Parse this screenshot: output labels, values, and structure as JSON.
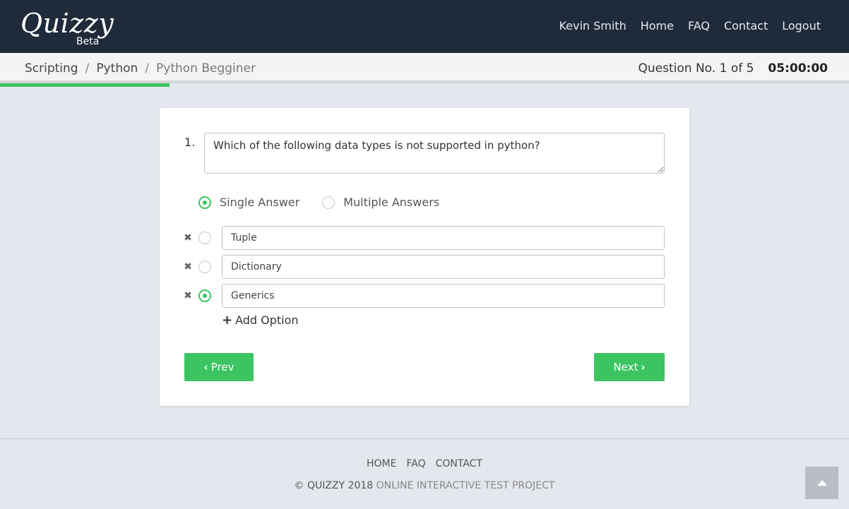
{
  "brand": {
    "name": "Quizzy",
    "tag": "Beta"
  },
  "nav": {
    "user": "Kevin Smith",
    "home": "Home",
    "faq": "FAQ",
    "contact": "Contact",
    "logout": "Logout"
  },
  "breadcrumb": {
    "items": [
      "Scripting",
      "Python",
      "Python Begginer"
    ],
    "separator": "/"
  },
  "quiz": {
    "question_counter": "Question No. 1 of 5",
    "timer": "05:00:00",
    "progress_fraction": 0.2
  },
  "question": {
    "number": "1.",
    "text": "Which of the following data types is not supported in python?",
    "answer_types": {
      "single": "Single Answer",
      "multiple": "Multiple Answers",
      "selected": "single"
    },
    "options": [
      {
        "value": "Tuple",
        "correct": false
      },
      {
        "value": "Dictionary",
        "correct": false
      },
      {
        "value": "Generics",
        "correct": true
      }
    ],
    "add_option_label": "Add Option"
  },
  "buttons": {
    "prev": "Prev",
    "next": "Next"
  },
  "footer": {
    "links": {
      "home": "HOME",
      "faq": "FAQ",
      "contact": "CONTACT"
    },
    "copyright_main": "© QUIZZY 2018",
    "copyright_sub": "ONLINE INTERACTIVE TEST PROJECT"
  },
  "colors": {
    "topbar": "#1f2a3a",
    "accent": "#3cc463",
    "background": "#e4e7ee"
  },
  "icons": {
    "remove": "close-icon",
    "add": "plus-icon",
    "prev": "chevron-left-icon",
    "next": "chevron-right-icon",
    "scroll_top": "arrow-up-icon"
  }
}
